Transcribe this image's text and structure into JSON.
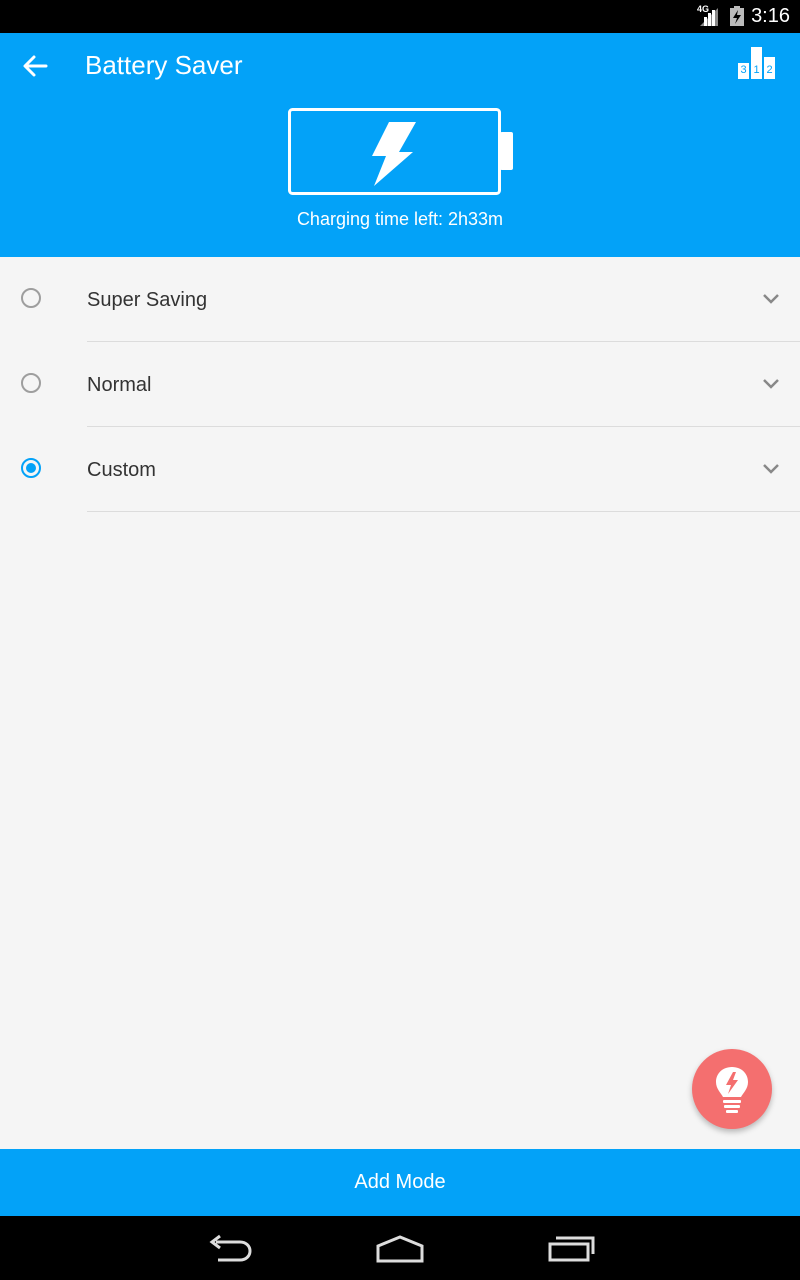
{
  "status_bar": {
    "network": "4G",
    "time": "3:16"
  },
  "header": {
    "title": "Battery Saver",
    "charging_text": "Charging time left: 2h33m",
    "rank_digits": [
      "3",
      "1",
      "2"
    ]
  },
  "modes": [
    {
      "label": "Super Saving",
      "selected": false
    },
    {
      "label": "Normal",
      "selected": false
    },
    {
      "label": "Custom",
      "selected": true
    }
  ],
  "add_mode_label": "Add Mode",
  "colors": {
    "primary": "#03a2f8",
    "fab": "#f46f6f"
  },
  "icons": {
    "back": "arrow-back-icon",
    "rank": "leaderboard-icon",
    "fab": "lightbulb-bolt-icon",
    "nav": [
      "back-nav-icon",
      "home-nav-icon",
      "recents-nav-icon"
    ]
  }
}
